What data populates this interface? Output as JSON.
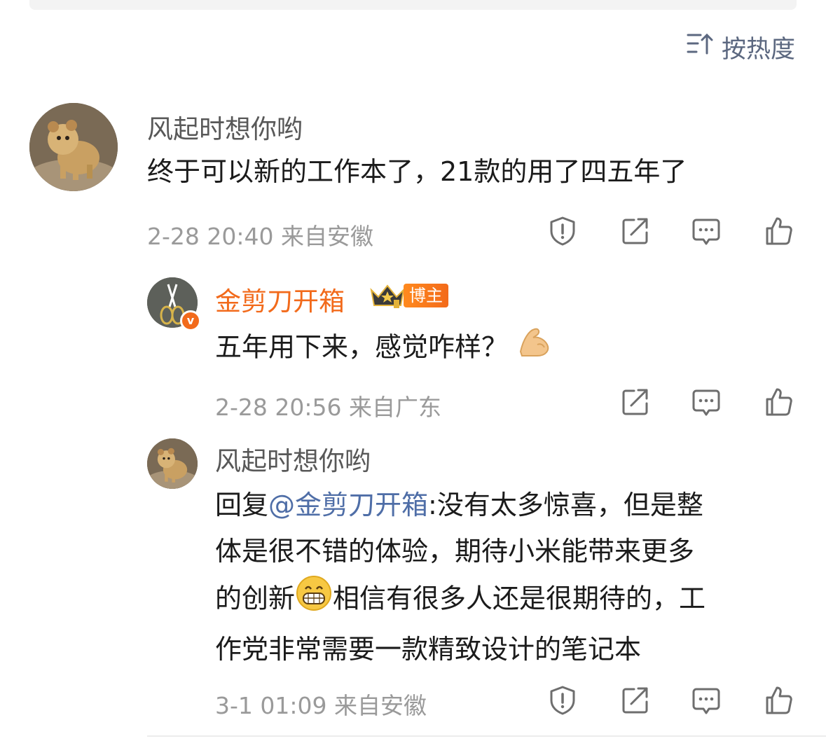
{
  "sort": {
    "label": "按热度",
    "icon": "sort-icon"
  },
  "comments": [
    {
      "name": "风起时想你哟",
      "text": "终于可以新的工作本了，21款的用了四五年了",
      "time": "2-28 20:40",
      "location": "来自安徽"
    }
  ],
  "replies": [
    {
      "name": "金剪刀开箱",
      "badge": "博主",
      "text": "五年用下来，感觉咋样？",
      "emoji": "flexed-biceps-emoji",
      "time": "2-28 20:56",
      "location": "来自广东"
    },
    {
      "name": "风起时想你哟",
      "reply_prefix": "回复",
      "mention": "@金剪刀开箱",
      "line1_rest": ":没有太多惊喜，但是整",
      "line2": "体是很不错的体验，期待小米能带来更多",
      "line3_a": "的创新",
      "emoji": "grinning-face-emoji",
      "line3_b": "相信有很多人还是很期待的，工",
      "line4": "作党非常需要一款精致设计的笔记本",
      "time": "3-1 01:09",
      "location": "来自安徽"
    }
  ],
  "colors": {
    "accent": "#f26a1b",
    "link": "#4f6ea7",
    "meta": "#9a9a9a"
  }
}
